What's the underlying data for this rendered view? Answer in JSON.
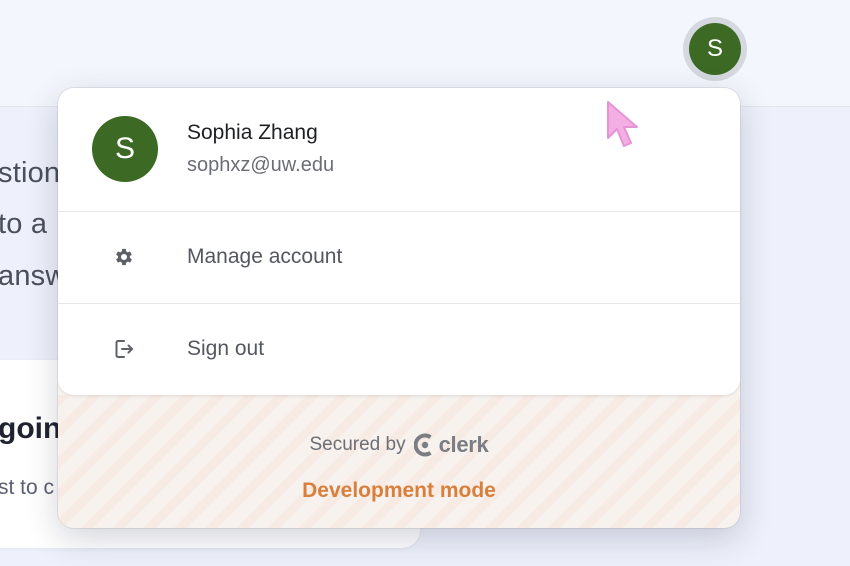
{
  "header": {
    "avatar_initial": "S"
  },
  "background": {
    "line1": "stion",
    "line2": "to a",
    "line3": "answ",
    "card_title": "goin",
    "card_sub": "st to c"
  },
  "popover": {
    "user": {
      "initial": "S",
      "name": "Sophia Zhang",
      "email": "sophxz@uw.edu"
    },
    "menu": [
      {
        "label": "Manage account",
        "icon": "gear-icon"
      },
      {
        "label": "Sign out",
        "icon": "sign-out-icon"
      }
    ],
    "footer": {
      "secured_by": "Secured by",
      "brand": "clerk",
      "mode": "Development mode"
    }
  },
  "colors": {
    "avatar_bg": "#3c6a24",
    "dev_mode": "#d97f3c"
  }
}
